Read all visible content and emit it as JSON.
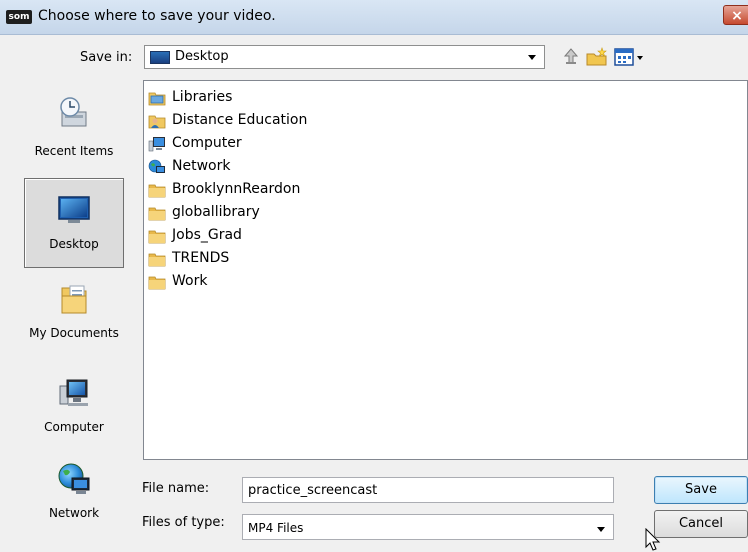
{
  "window": {
    "app_logo": "som",
    "title": "Choose where to save your video.",
    "close_glyph": "×"
  },
  "toolbar": {
    "save_in_label": "Save in:",
    "save_in_value": "Desktop",
    "icons": [
      "up-folder-icon",
      "new-folder-icon",
      "view-menu-icon"
    ]
  },
  "places": [
    {
      "label": "Recent Items",
      "icon": "recent-items-icon"
    },
    {
      "label": "Desktop",
      "icon": "desktop-icon",
      "selected": true
    },
    {
      "label": "My Documents",
      "icon": "documents-icon"
    },
    {
      "label": "Computer",
      "icon": "computer-icon"
    },
    {
      "label": "Network",
      "icon": "network-icon"
    }
  ],
  "files": [
    {
      "name": "Libraries",
      "icon": "libraries-icon"
    },
    {
      "name": "Distance Education",
      "icon": "user-folder-icon"
    },
    {
      "name": "Computer",
      "icon": "computer-icon"
    },
    {
      "name": "Network",
      "icon": "network-icon"
    },
    {
      "name": "BrooklynnReardon",
      "icon": "folder-icon"
    },
    {
      "name": "globallibrary",
      "icon": "folder-icon"
    },
    {
      "name": "Jobs_Grad",
      "icon": "folder-icon"
    },
    {
      "name": "TRENDS",
      "icon": "folder-icon"
    },
    {
      "name": "Work",
      "icon": "folder-icon"
    }
  ],
  "form": {
    "file_name_label": "File name:",
    "file_name_value": "practice_screencast",
    "file_type_label": "Files of type:",
    "file_type_value": "MP4 Files"
  },
  "buttons": {
    "save": "Save",
    "cancel": "Cancel"
  },
  "colors": {
    "accent": "#3c7fb1",
    "folder": "#e8b84a"
  }
}
